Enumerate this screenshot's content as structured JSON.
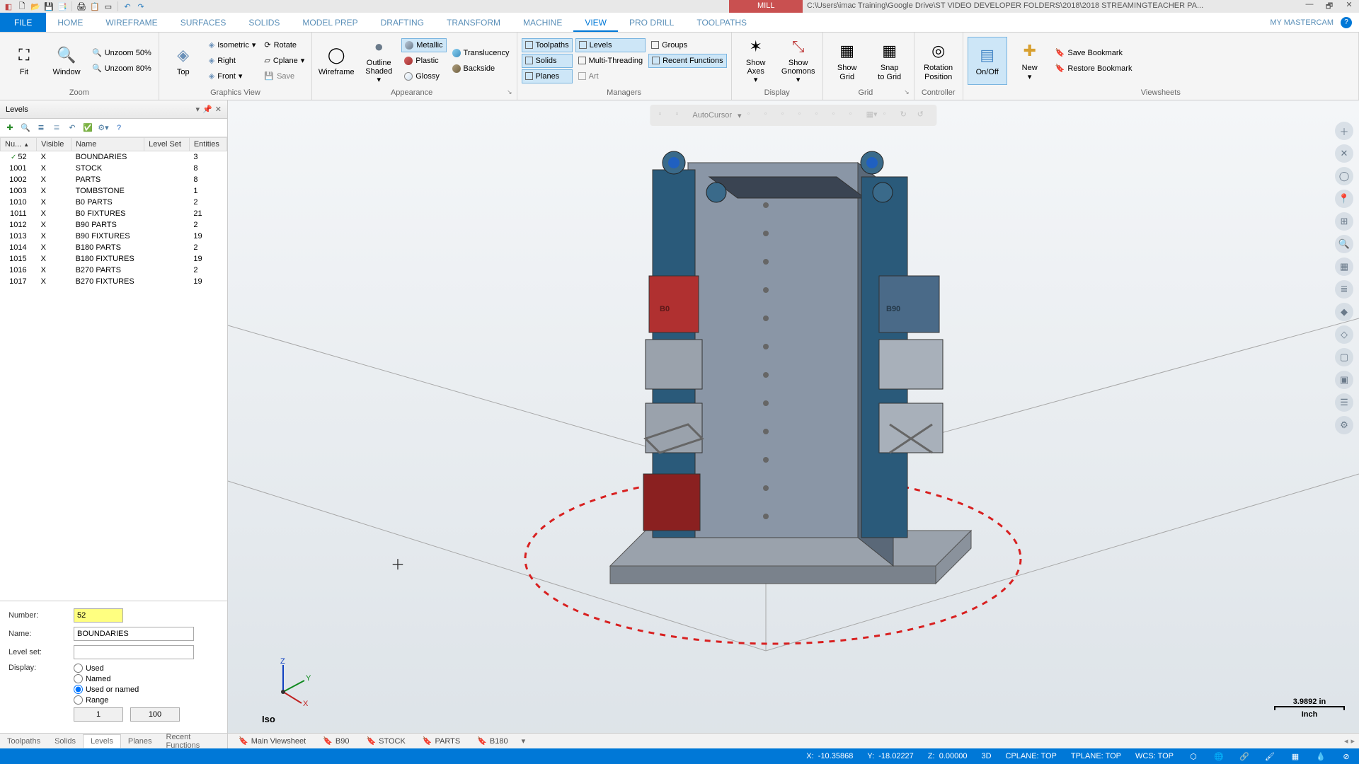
{
  "title": {
    "context_tab": "MILL",
    "path": "C:\\Users\\imac Training\\Google Drive\\ST VIDEO DEVELOPER FOLDERS\\2018\\2018 STREAMINGTEACHER PA..."
  },
  "tabs": {
    "file": "FILE",
    "home": "HOME",
    "wireframe": "WIREFRAME",
    "surfaces": "SURFACES",
    "solids": "SOLIDS",
    "modelprep": "MODEL PREP",
    "drafting": "DRAFTING",
    "transform": "TRANSFORM",
    "machine": "MACHINE",
    "view": "VIEW",
    "prodrill": "PRO DRILL",
    "toolpaths": "TOOLPATHS",
    "mymastercam": "MY MASTERCAM"
  },
  "ribbon": {
    "zoom": {
      "fit": "Fit",
      "window": "Window",
      "unzoom50": "Unzoom 50%",
      "unzoom80": "Unzoom 80%",
      "label": "Zoom"
    },
    "graphics": {
      "top": "Top",
      "isometric": "Isometric",
      "right": "Right",
      "front": "Front",
      "rotate": "Rotate",
      "cplane": "Cplane",
      "save": "Save",
      "label": "Graphics View"
    },
    "appearance": {
      "wireframe": "Wireframe",
      "outline": "Outline Shaded",
      "metallic": "Metallic",
      "plastic": "Plastic",
      "glossy": "Glossy",
      "translucency": "Translucency",
      "backside": "Backside",
      "label": "Appearance"
    },
    "managers": {
      "toolpaths": "Toolpaths",
      "solids": "Solids",
      "planes": "Planes",
      "levels": "Levels",
      "multith": "Multi-Threading",
      "art": "Art",
      "groups": "Groups",
      "recent": "Recent Functions",
      "label": "Managers"
    },
    "display": {
      "axes": "Show\nAxes",
      "gnomons": "Show\nGnomons",
      "label": "Display"
    },
    "grid": {
      "showgrid": "Show\nGrid",
      "snap": "Snap\nto Grid",
      "label": "Grid"
    },
    "controller": {
      "rotpos": "Rotation\nPosition",
      "label": "Controller"
    },
    "viewsheets": {
      "onoff": "On/Off",
      "new": "New",
      "savebm": "Save Bookmark",
      "restorebm": "Restore Bookmark",
      "label": "Viewsheets"
    }
  },
  "levels_panel": {
    "title": "Levels",
    "columns": {
      "number": "Nu...",
      "visible": "Visible",
      "name": "Name",
      "levelset": "Level Set",
      "entities": "Entities"
    },
    "rows": [
      {
        "n": "52",
        "v": "X",
        "name": "BOUNDARIES",
        "set": "",
        "ent": "3",
        "checked": true
      },
      {
        "n": "1001",
        "v": "X",
        "name": "STOCK",
        "set": "",
        "ent": "8"
      },
      {
        "n": "1002",
        "v": "X",
        "name": "PARTS",
        "set": "",
        "ent": "8"
      },
      {
        "n": "1003",
        "v": "X",
        "name": "TOMBSTONE",
        "set": "",
        "ent": "1"
      },
      {
        "n": "1010",
        "v": "X",
        "name": "B0 PARTS",
        "set": "",
        "ent": "2"
      },
      {
        "n": "1011",
        "v": "X",
        "name": "B0 FIXTURES",
        "set": "",
        "ent": "21"
      },
      {
        "n": "1012",
        "v": "X",
        "name": "B90 PARTS",
        "set": "",
        "ent": "2"
      },
      {
        "n": "1013",
        "v": "X",
        "name": "B90 FIXTURES",
        "set": "",
        "ent": "19"
      },
      {
        "n": "1014",
        "v": "X",
        "name": "B180 PARTS",
        "set": "",
        "ent": "2"
      },
      {
        "n": "1015",
        "v": "X",
        "name": "B180 FIXTURES",
        "set": "",
        "ent": "19"
      },
      {
        "n": "1016",
        "v": "X",
        "name": "B270 PARTS",
        "set": "",
        "ent": "2"
      },
      {
        "n": "1017",
        "v": "X",
        "name": "B270 FIXTURES",
        "set": "",
        "ent": "19"
      }
    ],
    "form": {
      "number_lbl": "Number:",
      "number_val": "52",
      "name_lbl": "Name:",
      "name_val": "BOUNDARIES",
      "levelset_lbl": "Level set:",
      "levelset_val": "",
      "display_lbl": "Display:",
      "opt_used": "Used",
      "opt_named": "Named",
      "opt_usedornamed": "Used or named",
      "opt_range": "Range",
      "range_lo": "1",
      "range_hi": "100"
    },
    "tabs": {
      "toolpaths": "Toolpaths",
      "solids": "Solids",
      "levels": "Levels",
      "planes": "Planes",
      "recent": "Recent Functions"
    }
  },
  "viewport": {
    "autocursor": "AutoCursor",
    "iso_label": "Iso",
    "scale_val": "3.9892 in",
    "scale_unit": "Inch",
    "face_b0": "B0",
    "face_b90": "B90"
  },
  "viewsheets_tabs": {
    "main": "Main Viewsheet",
    "b90": "B90",
    "stock": "STOCK",
    "parts": "PARTS",
    "b180": "B180"
  },
  "statusbar": {
    "x": "X:",
    "xv": "-10.35868",
    "y": "Y:",
    "yv": "-18.02227",
    "z": "Z:",
    "zv": "0.00000",
    "mode": "3D",
    "cplane": "CPLANE: TOP",
    "tplane": "TPLANE: TOP",
    "wcs": "WCS: TOP"
  }
}
